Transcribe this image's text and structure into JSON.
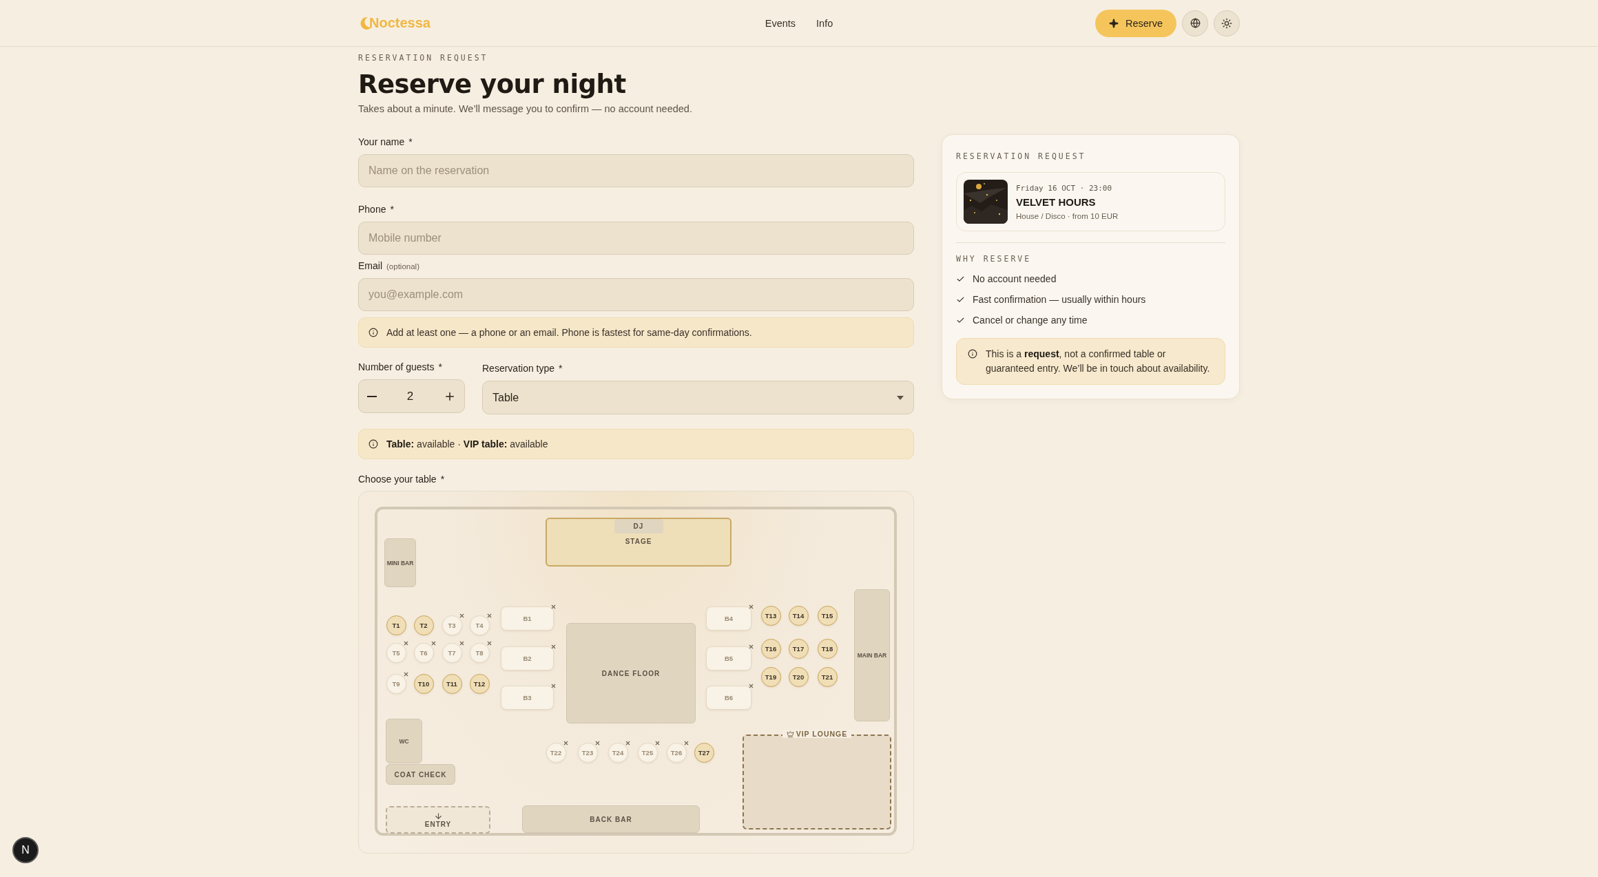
{
  "header": {
    "logo": "Noctessa",
    "nav": [
      {
        "label": "Events"
      },
      {
        "label": "Info"
      }
    ],
    "reserve_button": "Reserve"
  },
  "form": {
    "eyebrow": "RESERVATION REQUEST",
    "title": "Reserve your night",
    "subtitle": "Takes about a minute. We’ll message you to confirm — no account needed.",
    "name": {
      "label": "Your name",
      "required_mark": "*",
      "placeholder": "Name on the reservation"
    },
    "phone": {
      "label": "Phone",
      "required_mark": "*",
      "placeholder": "Mobile number"
    },
    "email": {
      "label": "Email",
      "hint": "(optional)",
      "placeholder": "you@example.com"
    },
    "contact_note": "Add at least one — a phone or an email. Phone is fastest for same-day confirmations.",
    "guests": {
      "label": "Number of guests",
      "required_mark": "*",
      "value": "2"
    },
    "reservation_type": {
      "label": "Reservation type",
      "required_mark": "*",
      "value": "Table"
    },
    "availability_note": "**Table:** available · **VIP table:** available",
    "table_picker": {
      "label": "Choose your table",
      "required_mark": "*"
    }
  },
  "floor_plan": {
    "stage": {
      "label": "STAGE",
      "dj": "DJ"
    },
    "areas": [
      {
        "kind": "fixture",
        "label": "MINI BAR"
      },
      {
        "kind": "floor",
        "label": "DANCE FLOOR"
      },
      {
        "kind": "fixture",
        "label": "MAIN BAR"
      },
      {
        "kind": "fixture",
        "label": "WC"
      },
      {
        "kind": "fixture",
        "label": "COAT CHECK"
      },
      {
        "kind": "entry",
        "label": "ENTRY"
      },
      {
        "kind": "fixture",
        "label": "BACK BAR"
      },
      {
        "kind": "vip",
        "label": "VIP LOUNGE"
      }
    ],
    "booths": [
      {
        "label": "B1",
        "available": false
      },
      {
        "label": "B2",
        "available": false
      },
      {
        "label": "B3",
        "available": false
      },
      {
        "label": "B4",
        "available": false
      },
      {
        "label": "B5",
        "available": false
      },
      {
        "label": "B6",
        "available": false
      }
    ],
    "tables": [
      {
        "label": "T1",
        "available": true
      },
      {
        "label": "T2",
        "available": true
      },
      {
        "label": "T3",
        "available": false
      },
      {
        "label": "T4",
        "available": false
      },
      {
        "label": "T5",
        "available": false
      },
      {
        "label": "T6",
        "available": false
      },
      {
        "label": "T7",
        "available": false
      },
      {
        "label": "T8",
        "available": false
      },
      {
        "label": "T9",
        "available": false
      },
      {
        "label": "T10",
        "available": true
      },
      {
        "label": "T11",
        "available": true
      },
      {
        "label": "T12",
        "available": true
      },
      {
        "label": "T13",
        "available": true
      },
      {
        "label": "T14",
        "available": true
      },
      {
        "label": "T15",
        "available": true
      },
      {
        "label": "T16",
        "available": true
      },
      {
        "label": "T17",
        "available": true
      },
      {
        "label": "T18",
        "available": true
      },
      {
        "label": "T19",
        "available": true
      },
      {
        "label": "T20",
        "available": true
      },
      {
        "label": "T21",
        "available": true
      },
      {
        "label": "T22",
        "available": false
      },
      {
        "label": "T23",
        "available": false
      },
      {
        "label": "T24",
        "available": false
      },
      {
        "label": "T25",
        "available": false
      },
      {
        "label": "T26",
        "available": false
      },
      {
        "label": "T27",
        "available": true
      }
    ]
  },
  "summary": {
    "eyebrow": "RESERVATION REQUEST",
    "event": {
      "date": "Friday 16 OCT · 23:00",
      "title": "VELVET HOURS",
      "meta": "House / Disco · from 10 EUR"
    },
    "why_title": "WHY RESERVE",
    "reasons": [
      "No account needed",
      "Fast confirmation — usually within hours",
      "Cancel or change any time"
    ],
    "note": "This is a **request**, not a confirmed table or guaranteed entry. We’ll be in touch about availability."
  },
  "dev_badge": "N"
}
